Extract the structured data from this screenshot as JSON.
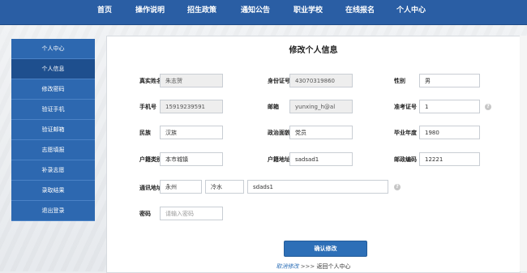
{
  "nav": {
    "items": [
      "首页",
      "操作说明",
      "招生政策",
      "通知公告",
      "职业学校",
      "在线报名",
      "个人中心"
    ]
  },
  "sidebar": {
    "items": [
      "个人中心",
      "个人信息",
      "修改密码",
      "验证手机",
      "验证邮箱",
      "志愿填报",
      "补录志愿",
      "录取结果",
      "退出登录"
    ],
    "active_index": 1
  },
  "form": {
    "title": "修改个人信息",
    "real_name": {
      "label": "真实姓名",
      "value": "朱志贺"
    },
    "id_number": {
      "label": "身份证号",
      "value": "43070319860"
    },
    "gender": {
      "label": "性别",
      "value": "男"
    },
    "phone": {
      "label": "手机号",
      "value": "15919239591"
    },
    "email": {
      "label": "邮箱",
      "value": "yunxing_h@al"
    },
    "ticket_no": {
      "label": "准考证号",
      "value": "1"
    },
    "ethnicity": {
      "label": "民族",
      "value": "汉族"
    },
    "political": {
      "label": "政治面貌",
      "value": "党员"
    },
    "grad_year": {
      "label": "毕业年度",
      "value": "1980"
    },
    "hukou_type": {
      "label": "户籍类别",
      "value": "本市城镇"
    },
    "hukou_addr": {
      "label": "户籍地址",
      "value": "sadsad1"
    },
    "postcode": {
      "label": "邮政编码",
      "value": "12221"
    },
    "mail_addr": {
      "label": "通讯地址",
      "city": "永州",
      "district": "冷水",
      "detail": "sdads1"
    },
    "password": {
      "label": "密码",
      "placeholder": "请输入密码"
    },
    "submit_label": "确认修改",
    "cancel_label": "取消修改",
    "separator": ">>>",
    "back_label": "返回个人中心",
    "help_glyph": "?"
  }
}
